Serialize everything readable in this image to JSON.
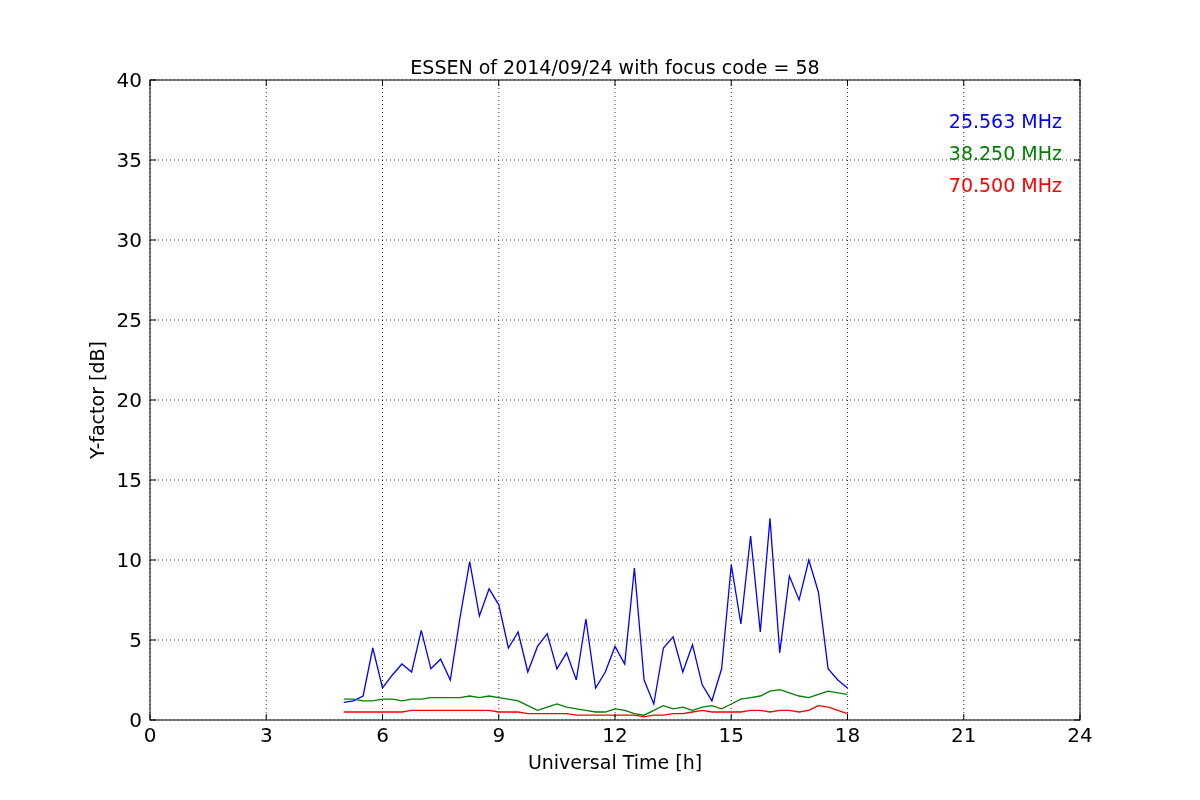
{
  "chart_data": {
    "type": "line",
    "title": "ESSEN of 2014/09/24 with focus code = 58",
    "xlabel": "Universal Time [h]",
    "ylabel": "Y-factor [dB]",
    "x": [
      5,
      5.25,
      5.5,
      5.75,
      6,
      6.25,
      6.5,
      6.75,
      7,
      7.25,
      7.5,
      7.75,
      8,
      8.25,
      8.5,
      8.75,
      9,
      9.25,
      9.5,
      9.75,
      10,
      10.25,
      10.5,
      10.75,
      11,
      11.25,
      11.5,
      11.75,
      12,
      12.25,
      12.5,
      12.75,
      13,
      13.25,
      13.5,
      13.75,
      14,
      14.25,
      14.5,
      14.75,
      15,
      15.25,
      15.5,
      15.75,
      16,
      16.25,
      16.5,
      16.75,
      17,
      17.25,
      17.5,
      17.75,
      18
    ],
    "series": [
      {
        "name": "25.563 MHz",
        "color": "#0000ff",
        "values": [
          1.1,
          1.2,
          1.5,
          4.5,
          2.0,
          2.8,
          3.5,
          3.0,
          5.6,
          3.2,
          3.8,
          2.5,
          6.4,
          9.9,
          6.5,
          8.2,
          7.2,
          4.5,
          5.5,
          3.0,
          4.6,
          5.4,
          3.2,
          4.2,
          2.5,
          6.3,
          2.0,
          3.0,
          4.6,
          3.5,
          9.5,
          2.5,
          1.0,
          4.5,
          5.2,
          3.0,
          4.7,
          2.2,
          1.2,
          3.2,
          9.7,
          6.0,
          11.5,
          5.5,
          12.6,
          4.2,
          9.0,
          7.5,
          10.0,
          8.0,
          3.2,
          2.5,
          2.0
        ]
      },
      {
        "name": "38.250 MHz",
        "color": "#008000",
        "values": [
          1.3,
          1.3,
          1.2,
          1.2,
          1.3,
          1.3,
          1.2,
          1.3,
          1.3,
          1.4,
          1.4,
          1.4,
          1.4,
          1.5,
          1.4,
          1.5,
          1.4,
          1.3,
          1.2,
          0.9,
          0.6,
          0.8,
          1.0,
          0.8,
          0.7,
          0.6,
          0.5,
          0.5,
          0.7,
          0.6,
          0.4,
          0.3,
          0.6,
          0.9,
          0.7,
          0.8,
          0.6,
          0.8,
          0.9,
          0.7,
          1.0,
          1.3,
          1.4,
          1.5,
          1.8,
          1.9,
          1.7,
          1.5,
          1.4,
          1.6,
          1.8,
          1.7,
          1.6
        ]
      },
      {
        "name": "70.500 MHz",
        "color": "#ff0000",
        "values": [
          0.5,
          0.5,
          0.5,
          0.5,
          0.5,
          0.5,
          0.5,
          0.6,
          0.6,
          0.6,
          0.6,
          0.6,
          0.6,
          0.6,
          0.6,
          0.6,
          0.5,
          0.5,
          0.5,
          0.4,
          0.4,
          0.4,
          0.4,
          0.4,
          0.3,
          0.3,
          0.3,
          0.3,
          0.3,
          0.3,
          0.3,
          0.2,
          0.3,
          0.3,
          0.4,
          0.4,
          0.5,
          0.6,
          0.5,
          0.5,
          0.5,
          0.5,
          0.6,
          0.6,
          0.5,
          0.6,
          0.6,
          0.5,
          0.6,
          0.9,
          0.8,
          0.6,
          0.4
        ]
      }
    ],
    "grid": true,
    "xlim": [
      0,
      24
    ],
    "ylim": [
      0,
      40
    ],
    "xticks": [
      0,
      3,
      6,
      9,
      12,
      15,
      18,
      21,
      24
    ],
    "yticks": [
      0,
      5,
      10,
      15,
      20,
      25,
      30,
      35,
      40
    ]
  }
}
